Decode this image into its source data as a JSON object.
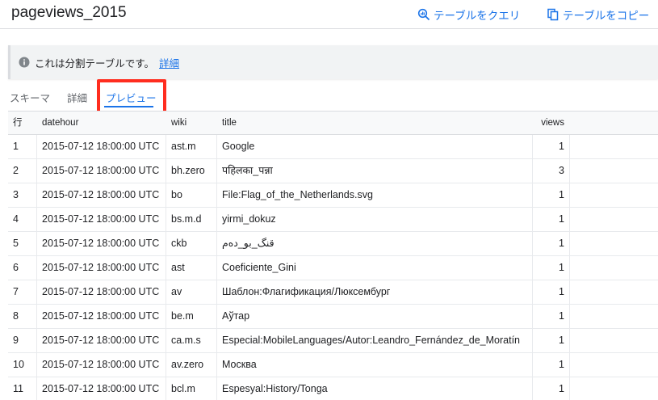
{
  "header": {
    "title": "pageviews_2015",
    "query_label": "テーブルをクエリ",
    "copy_label": "テーブルをコピー"
  },
  "notice": {
    "text": "これは分割テーブルです。",
    "link": "詳細"
  },
  "tabs": [
    {
      "label": "スキーマ"
    },
    {
      "label": "詳細"
    },
    {
      "label": "プレビュー",
      "selected": true
    }
  ],
  "table": {
    "columns": [
      "行",
      "datehour",
      "wiki",
      "title",
      "views"
    ],
    "rows": [
      {
        "n": "1",
        "datehour": "2015-07-12 18:00:00 UTC",
        "wiki": "ast.m",
        "title": "Google",
        "views": "1"
      },
      {
        "n": "2",
        "datehour": "2015-07-12 18:00:00 UTC",
        "wiki": "bh.zero",
        "title": "पहिलका_पन्ना",
        "views": "3"
      },
      {
        "n": "3",
        "datehour": "2015-07-12 18:00:00 UTC",
        "wiki": "bo",
        "title": "File:Flag_of_the_Netherlands.svg",
        "views": "1"
      },
      {
        "n": "4",
        "datehour": "2015-07-12 18:00:00 UTC",
        "wiki": "bs.m.d",
        "title": "yirmi_dokuz",
        "views": "1"
      },
      {
        "n": "5",
        "datehour": "2015-07-12 18:00:00 UTC",
        "wiki": "ckb",
        "title": "قنگ_بو_دەم",
        "views": "1"
      },
      {
        "n": "6",
        "datehour": "2015-07-12 18:00:00 UTC",
        "wiki": "ast",
        "title": "Coeficiente_Gini",
        "views": "1"
      },
      {
        "n": "7",
        "datehour": "2015-07-12 18:00:00 UTC",
        "wiki": "av",
        "title": "Шаблон:Флагификация/Люксембург",
        "views": "1"
      },
      {
        "n": "8",
        "datehour": "2015-07-12 18:00:00 UTC",
        "wiki": "be.m",
        "title": "Аўтар",
        "views": "1"
      },
      {
        "n": "9",
        "datehour": "2015-07-12 18:00:00 UTC",
        "wiki": "ca.m.s",
        "title": "Especial:MobileLanguages/Autor:Leandro_Fernández_de_Moratín",
        "views": "1"
      },
      {
        "n": "10",
        "datehour": "2015-07-12 18:00:00 UTC",
        "wiki": "av.zero",
        "title": "Москва",
        "views": "1"
      },
      {
        "n": "11",
        "datehour": "2015-07-12 18:00:00 UTC",
        "wiki": "bcl.m",
        "title": "Espesyal:History/Tonga",
        "views": "1"
      }
    ]
  },
  "icons": {
    "query": "query-table-icon",
    "copy": "copy-icon",
    "info": "info-icon"
  },
  "colors": {
    "accent": "#1a73e8",
    "highlight": "#ff2d1f"
  }
}
